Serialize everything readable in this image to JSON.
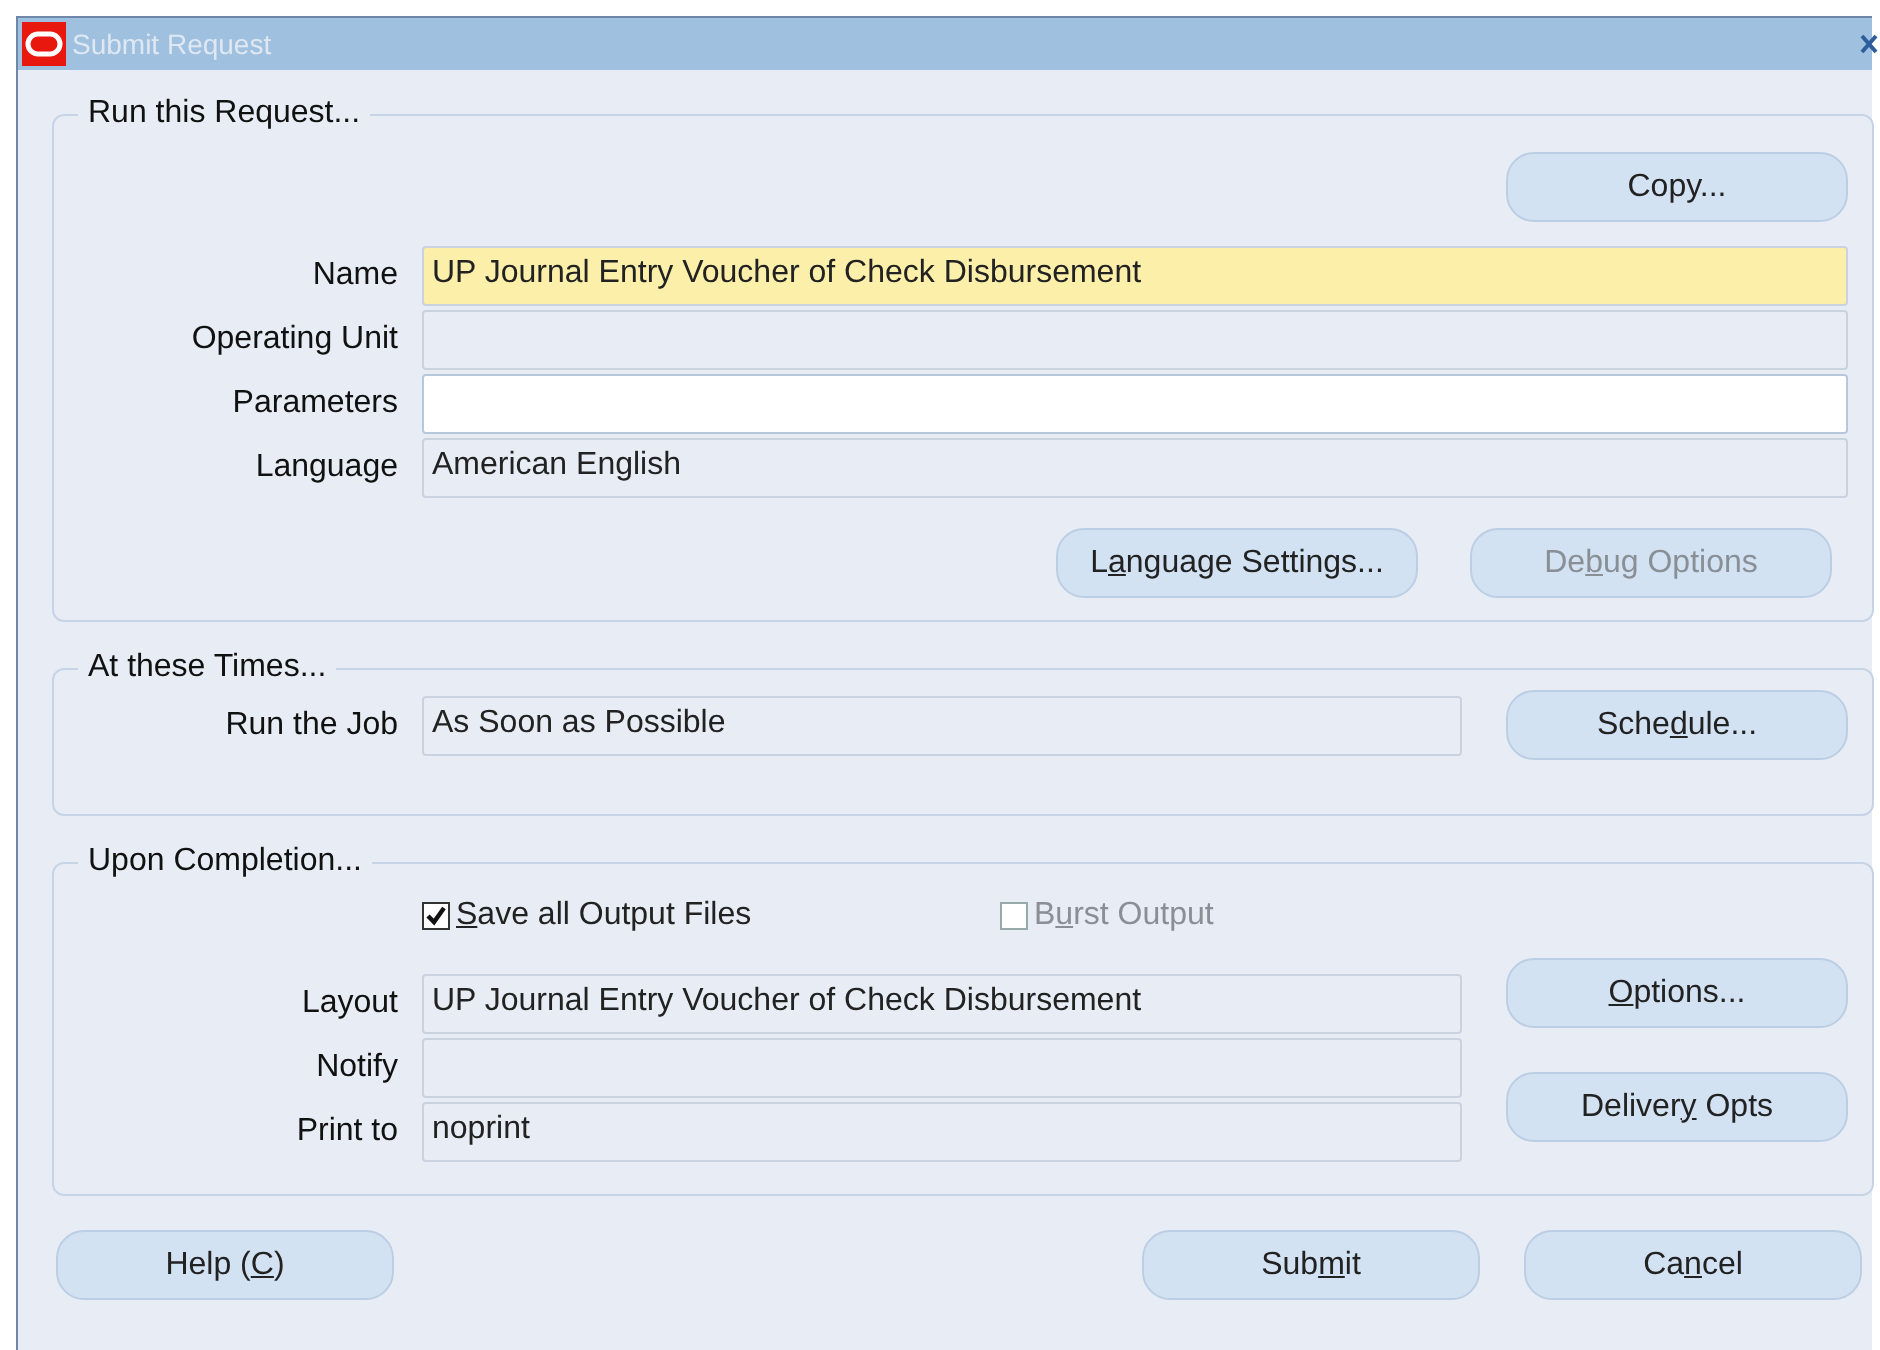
{
  "window": {
    "title": "Submit Request"
  },
  "run_request": {
    "legend": "Run this Request...",
    "copy_button": {
      "label": "Copy...",
      "disabled": false
    },
    "fields": [
      {
        "label": "Name",
        "value": "UP Journal Entry Voucher of Check Disbursement",
        "kind": "required"
      },
      {
        "label": "Operating Unit",
        "kind": "readonly"
      },
      {
        "label": "Parameters",
        "kind": "editable"
      },
      {
        "label": "Language",
        "value": "American English",
        "kind": "readonly"
      }
    ],
    "buttons": [
      {
        "pre": "L",
        "key": "a",
        "post": "nguage Settings...",
        "disabled": false
      },
      {
        "pre": "De",
        "key": "b",
        "post": "ug Options",
        "disabled": true
      }
    ]
  },
  "times": {
    "legend": "At these Times...",
    "field": {
      "label": "Run the Job",
      "value": "As Soon as Possible"
    },
    "button": {
      "pre": "Sche",
      "key": "d",
      "post": "ule...",
      "disabled": false
    }
  },
  "completion": {
    "legend": "Upon Completion...",
    "checkboxes": [
      {
        "key": "S",
        "post": "ave all Output Files",
        "checked": true,
        "disabled": false
      },
      {
        "pre": "B",
        "key": "u",
        "post": "rst Output",
        "checked": false,
        "disabled": true
      }
    ],
    "fields": [
      {
        "label": "Layout",
        "value": "UP Journal Entry Voucher of Check Disbursement"
      },
      {
        "label": "Notify"
      },
      {
        "label": "Print to",
        "value": "noprint"
      }
    ],
    "buttons": [
      {
        "key": "O",
        "post": "ptions...",
        "disabled": false
      },
      {
        "pre": "Deliver",
        "key": "y",
        "post": " Opts",
        "disabled": false
      }
    ]
  },
  "footer": {
    "buttons": [
      {
        "pre": "Help (",
        "key": "C",
        "post": ")",
        "disabled": false,
        "kind": "help"
      },
      {
        "pre": "Sub",
        "key": "m",
        "post": "it",
        "disabled": false,
        "kind": "action"
      },
      {
        "pre": "Ca",
        "key": "n",
        "post": "cel",
        "disabled": false,
        "kind": "action"
      }
    ]
  }
}
